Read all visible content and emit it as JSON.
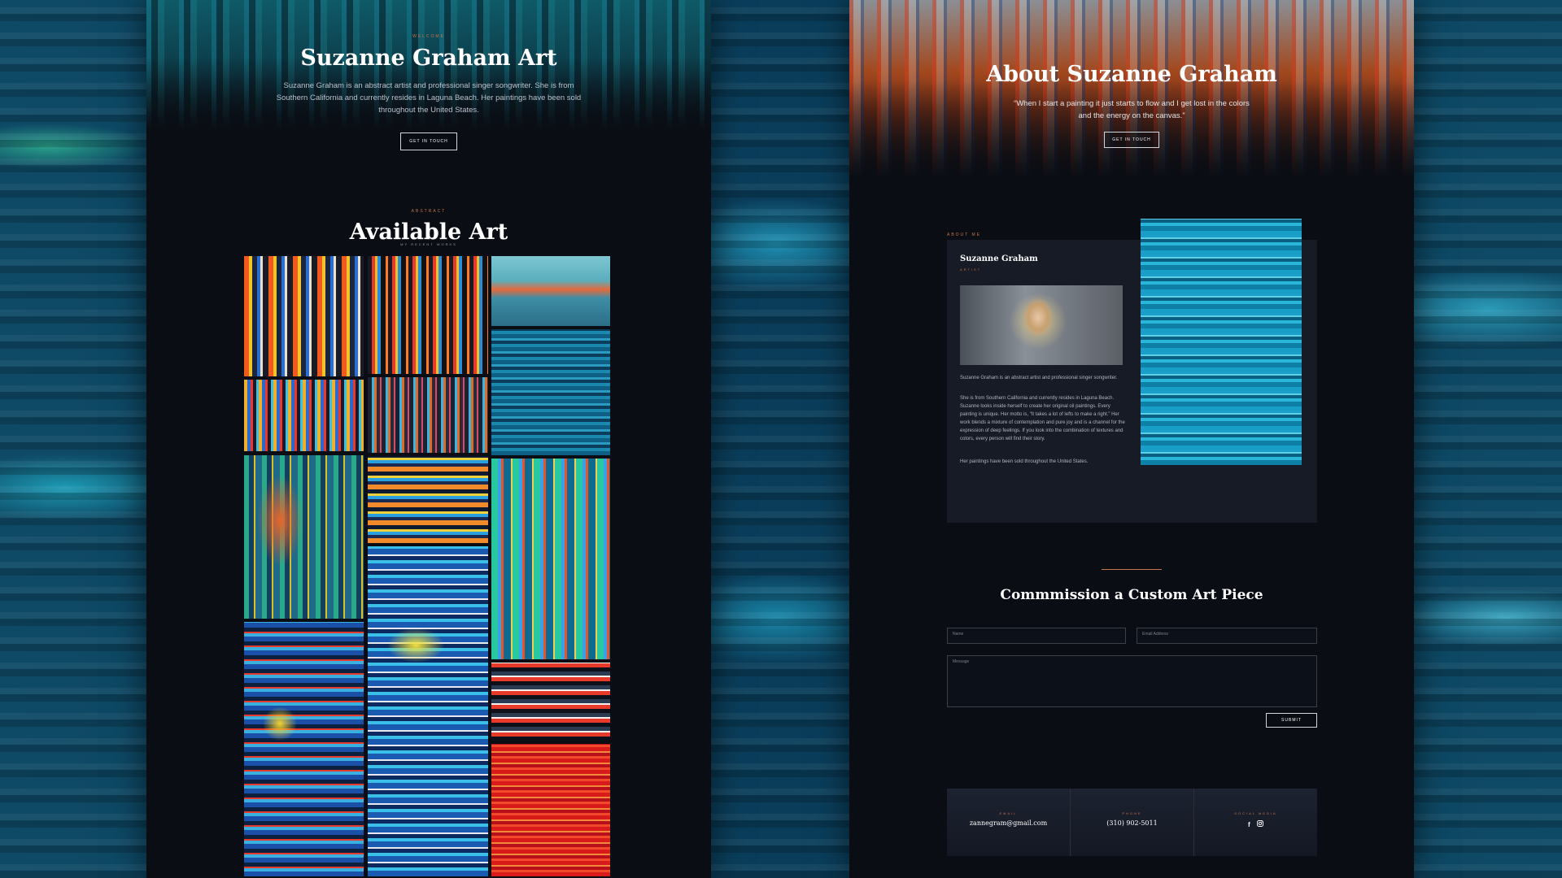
{
  "left": {
    "hero": {
      "eyebrow": "Welcome",
      "title": "Suzanne Graham Art",
      "description": "Suzanne Graham is an abstract artist and professional singer songwriter. She is from Southern California and currently resides in Laguna Beach. Her paintings have been sold throughout the United States.",
      "button": "GET IN TOUCH"
    },
    "gallery": {
      "eyebrow": "Abstract",
      "title": "Available Art",
      "subtitle": "MY RECENT WORKS"
    }
  },
  "right": {
    "hero": {
      "title": "About Suzanne Graham",
      "quote": "“When I start a painting it just starts to flow and I get lost in the colors and the energy on the canvas.”",
      "button": "GET IN TOUCH"
    },
    "about": {
      "eyebrow": "ABOUT ME",
      "name": "Suzanne Graham",
      "role": "ARTIST",
      "bio_1": "Suzanne Graham is an abstract artist and professional  singer songwriter.",
      "bio_2": "She is from Southern California and currently resides in Laguna Beach.  Suzanne looks inside herself to create  her original oil paintings. Every painting  is unique. Her motto is, “It takes a lot of  lefts to make a right.” Her work blends a mixture of contemplation and pure joy  and is a channel for the expression  of deep feelings. If you look into the  combination of textures and colors,  every person will find their story.",
      "bio_3": "Her paintings have been sold  throughout the United States."
    },
    "commission": {
      "title": "Commmission a Custom Art Piece",
      "name_placeholder": "Name",
      "email_placeholder": "Email Address",
      "message_placeholder": "Message",
      "submit": "SUBMIT"
    },
    "contact": {
      "email_label": "EMAIL",
      "email_value": "zannegram@gmail.com",
      "phone_label": "PHONE",
      "phone_value": "(310) 902-5011",
      "social_label": "SOCIAL MEDIA",
      "social_icons": [
        "facebook-icon",
        "instagram-icon"
      ]
    }
  },
  "colors": {
    "accent": "#c67449",
    "panel_bg": "#0a0d14",
    "card_bg": "#171b26"
  }
}
